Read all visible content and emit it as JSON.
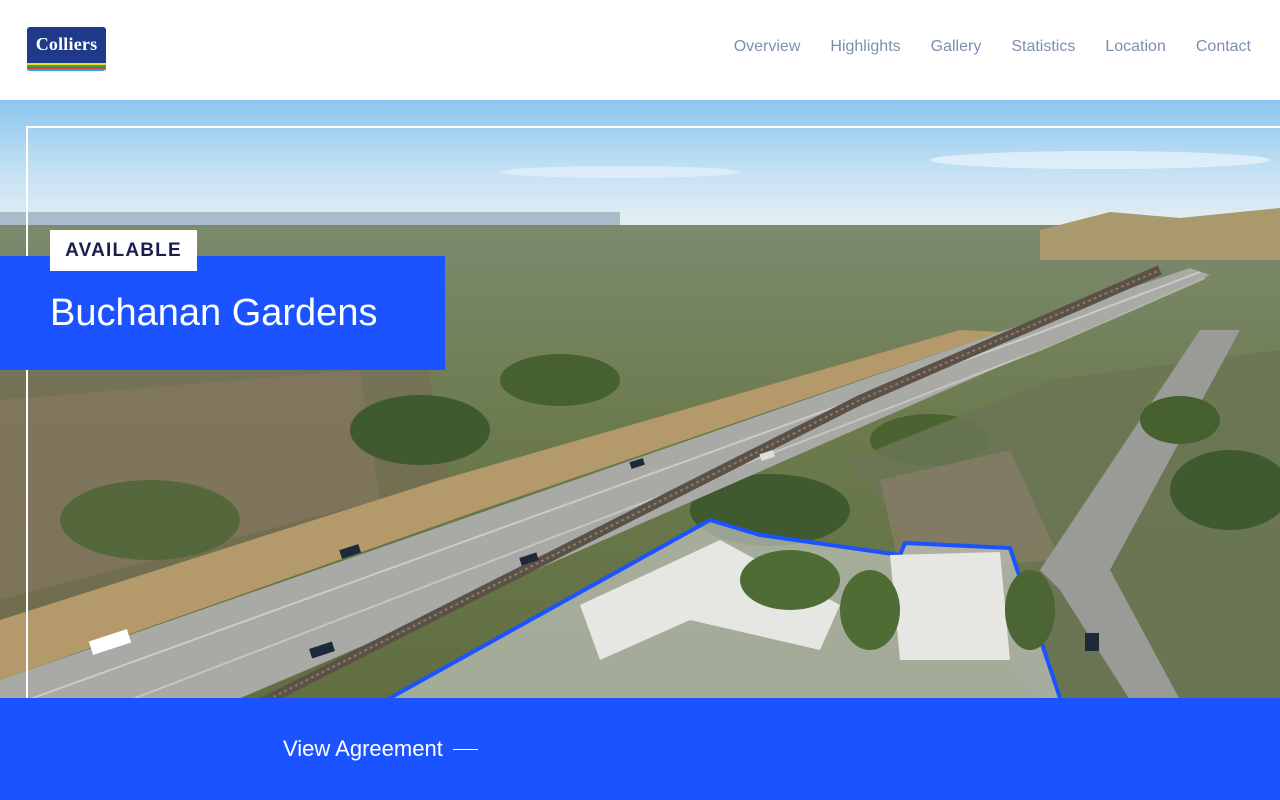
{
  "header": {
    "logo_text": "Colliers",
    "nav": [
      "Overview",
      "Highlights",
      "Gallery",
      "Statistics",
      "Location",
      "Contact"
    ]
  },
  "hero": {
    "badge": "AVAILABLE",
    "title": "Buchanan Gardens",
    "cta_label": "View Agreement"
  },
  "colors": {
    "brand_blue": "#1a53ff",
    "logo_navy": "#1f3a8a",
    "nav_text": "#7d8fae",
    "badge_text": "#1b1f4f"
  }
}
